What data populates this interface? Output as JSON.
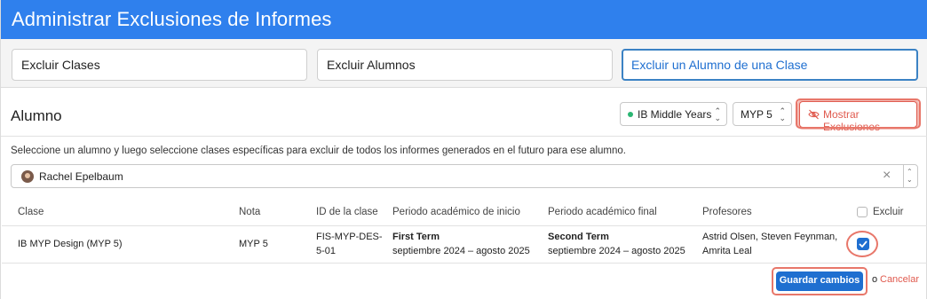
{
  "header": {
    "title": "Administrar Exclusiones de Informes"
  },
  "tabs": [
    {
      "label": "Excluir Clases",
      "active": false
    },
    {
      "label": "Excluir Alumnos",
      "active": false
    },
    {
      "label": "Excluir un Alumno de una Clase",
      "active": true
    }
  ],
  "section": {
    "title": "Alumno",
    "program_select": {
      "value": "IB Middle Years",
      "status_color": "#2bb673"
    },
    "grade_select": {
      "value": "MYP 5"
    },
    "show_exclusions_label": "Mostrar Exclusiones",
    "show_exclusions_icon": "eye-slash-icon"
  },
  "instructions": "Seleccione un alumno y luego seleccione clases específicas para excluir de todos los informes generados en el futuro para ese alumno.",
  "student_picker": {
    "value": "Rachel Epelbaum",
    "clear_glyph": "×"
  },
  "table": {
    "headers": {
      "clase": "Clase",
      "nota": "Nota",
      "id": "ID de la clase",
      "inicio": "Periodo académico de inicio",
      "final": "Periodo académico final",
      "profesores": "Profesores",
      "excluir": "Excluir"
    },
    "rows": [
      {
        "clase": "IB MYP Design (MYP 5)",
        "nota": "MYP 5",
        "id_line1": "FIS-MYP-DES-",
        "id_line2": "5-01",
        "inicio_term": "First Term",
        "inicio_range": "septiembre 2024 – agosto 2025",
        "final_term": "Second Term",
        "final_range": "septiembre 2024 – agosto 2025",
        "profesores_line1": "Astrid Olsen, Steven Feynman,",
        "profesores_line2": "Amrita Leal",
        "excluded": true
      }
    ]
  },
  "footer": {
    "save_label": "Guardar cambios",
    "or_label": "o",
    "cancel_label": "Cancelar"
  },
  "colors": {
    "brand": "#2f80ed",
    "primary": "#1f6fd0",
    "danger": "#e05a4e"
  }
}
